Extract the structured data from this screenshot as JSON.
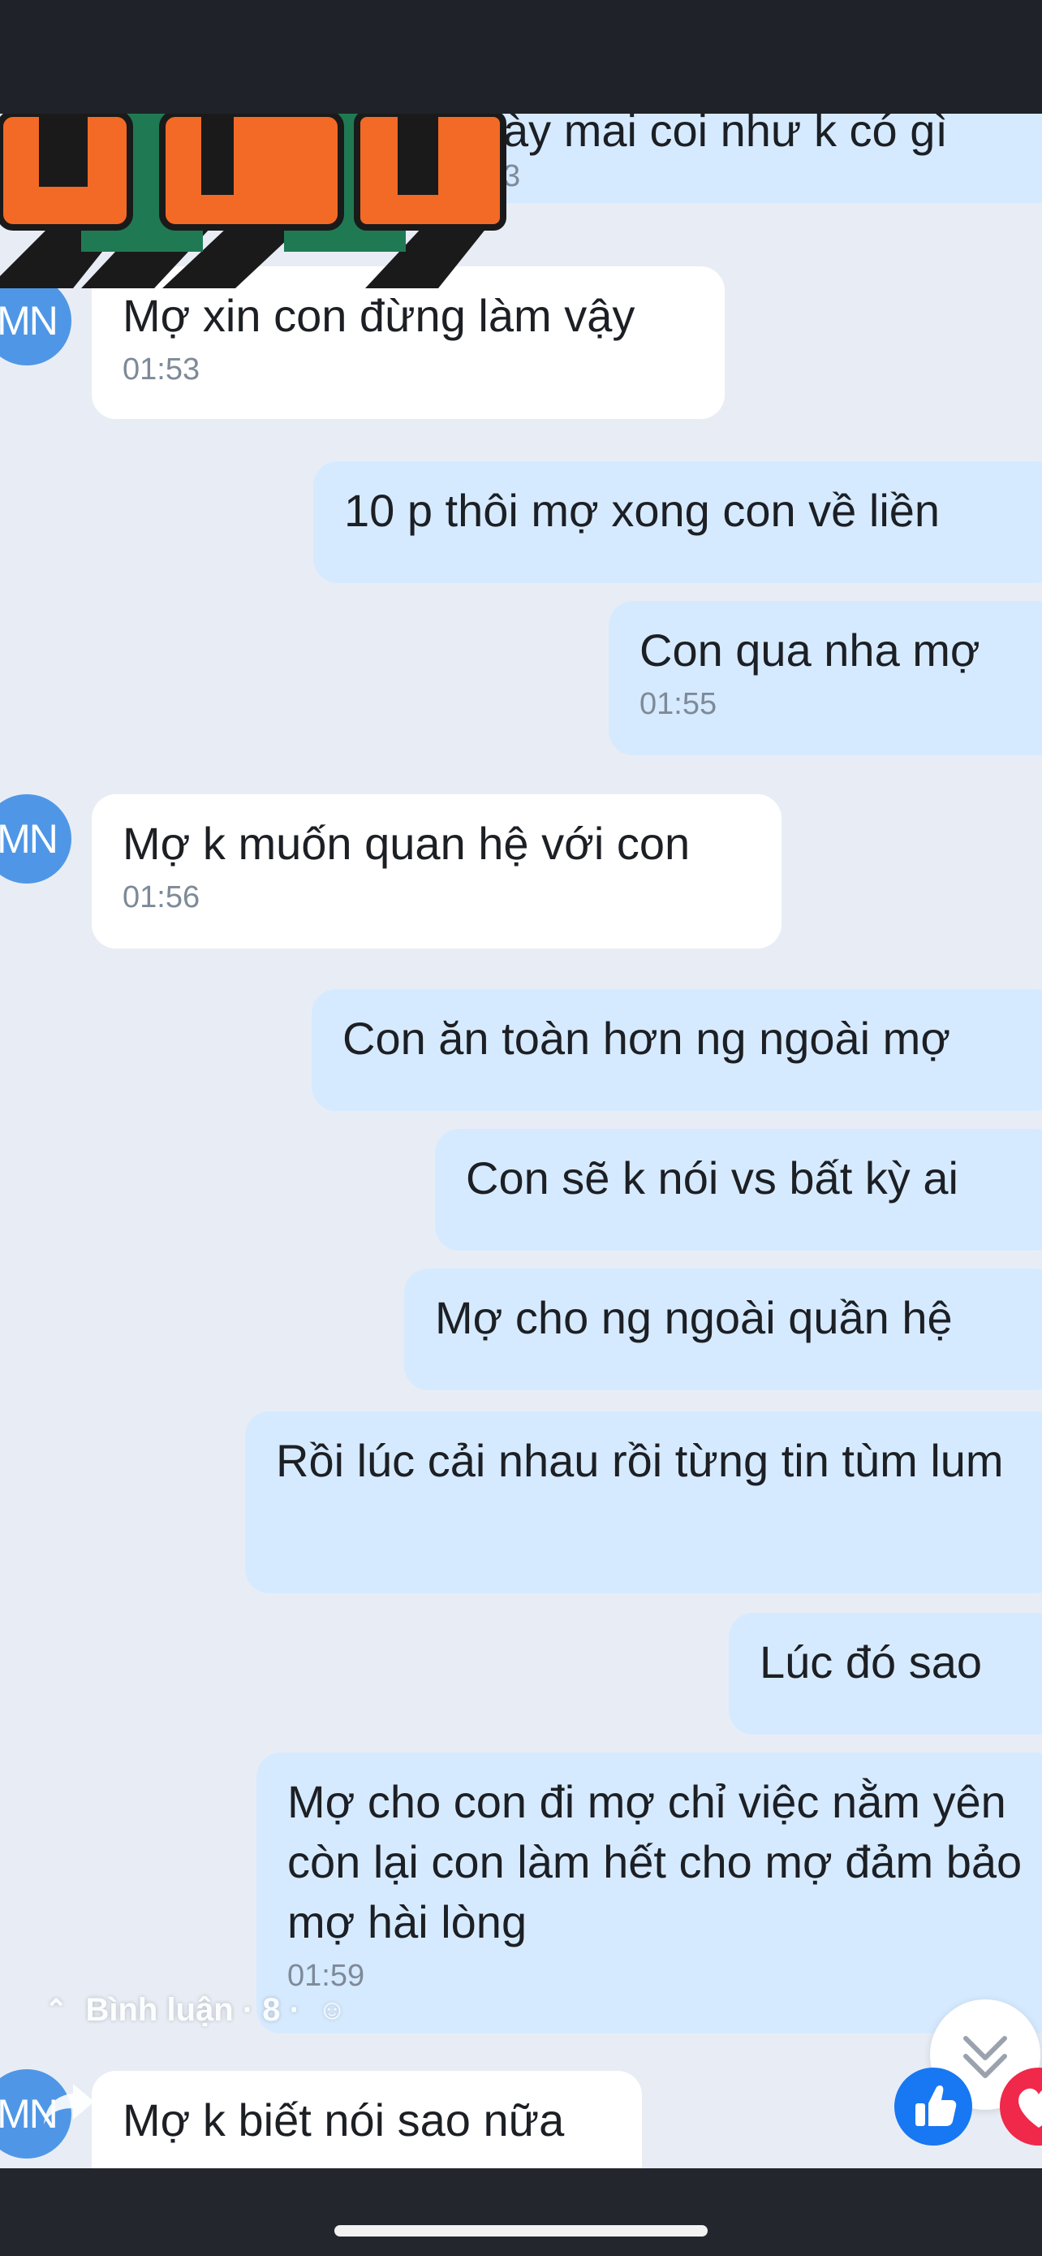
{
  "messages": [
    {
      "text": "ày mai coi như k có gì",
      "time": "3"
    },
    {
      "text": "Mợ xin con đừng làm vậy",
      "time": "01:53"
    },
    {
      "text": "10 p thôi mợ xong con về liền",
      "time": ""
    },
    {
      "text": "Con qua nha mợ",
      "time": "01:55"
    },
    {
      "text": "Mợ k muốn quan hệ với con",
      "time": "01:56"
    },
    {
      "text": "Con ăn toàn hơn ng ngoài mợ",
      "time": ""
    },
    {
      "text": "Con sẽ k nói vs bất kỳ ai",
      "time": ""
    },
    {
      "text": "Mợ cho ng ngoài quần hệ",
      "time": ""
    },
    {
      "text": "Rồi lúc cải nhau rồi từng tin tùm lum",
      "time": ""
    },
    {
      "text": "Lúc đó sao",
      "time": ""
    },
    {
      "text": "Mợ cho con đi mợ chỉ việc nằm yên còn lại con làm hết cho mợ đảm bảo mợ hài lòng",
      "time": "01:59"
    },
    {
      "text": "Mợ k biết nói sao nữa",
      "time": ""
    }
  ],
  "avatar_initials": "MN",
  "overlay": {
    "comments_label": "Bình luận · 8 · ",
    "like_icon": "thumbs-up-icon",
    "love_icon": "heart-icon",
    "share_icon": "share-arrow-icon",
    "scroll_icon": "double-chevron-down-icon"
  },
  "colors": {
    "outgoing_bubble": "#d6eaff",
    "incoming_bubble": "#ffffff",
    "chat_background": "#e8edf5",
    "avatar": "#4f97e6",
    "like_blue": "#1877f2",
    "love_red": "#f0284a"
  }
}
